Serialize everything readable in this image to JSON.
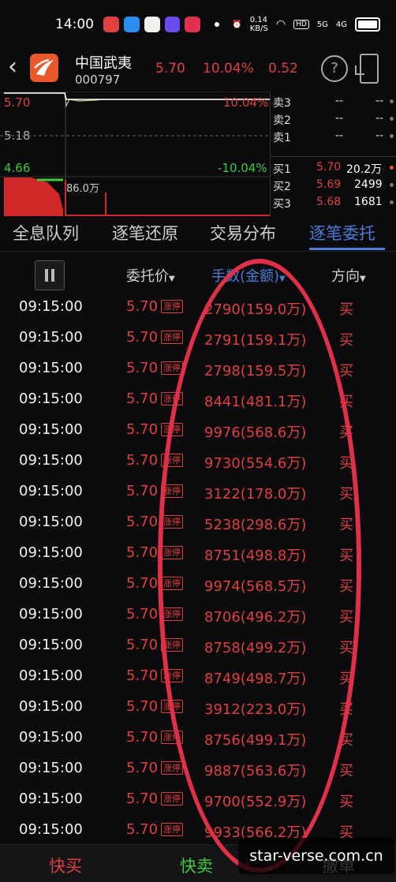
{
  "status": {
    "time": "14:00",
    "net_speed": "0.14",
    "net_unit": "KB/S",
    "hd": "HD",
    "sig1": "5G",
    "sig2": "4G"
  },
  "header": {
    "name": "中国武夷",
    "code": "000797",
    "price": "5.70",
    "pct": "10.04%",
    "change": "0.52"
  },
  "chart": {
    "high": "5.70",
    "high_pct": "10.04%",
    "mid": "5.18",
    "low": "4.66",
    "low_pct": "-10.04%",
    "vol": "86.0万"
  },
  "orderbook": [
    {
      "label": "卖3",
      "price": "--",
      "vol": "--"
    },
    {
      "label": "卖2",
      "price": "--",
      "vol": "--"
    },
    {
      "label": "卖1",
      "price": "--",
      "vol": "--"
    },
    {
      "label": "买1",
      "price": "5.70",
      "vol": "20.2万"
    },
    {
      "label": "买2",
      "price": "5.69",
      "vol": "2499"
    },
    {
      "label": "买3",
      "price": "5.68",
      "vol": "1681"
    }
  ],
  "tabs": [
    "全息队列",
    "逐笔还原",
    "交易分布",
    "逐笔委托"
  ],
  "columns": {
    "price": "委托价",
    "volume": "手数(金额)",
    "direction": "方向"
  },
  "limit_tag": "涨停",
  "rows": [
    {
      "time": "09:15:00",
      "price": "5.70",
      "vol": "2790(159.0万)",
      "dir": "买"
    },
    {
      "time": "09:15:00",
      "price": "5.70",
      "vol": "2791(159.1万)",
      "dir": "买"
    },
    {
      "time": "09:15:00",
      "price": "5.70",
      "vol": "2798(159.5万)",
      "dir": "买"
    },
    {
      "time": "09:15:00",
      "price": "5.70",
      "vol": "8441(481.1万)",
      "dir": "买"
    },
    {
      "time": "09:15:00",
      "price": "5.70",
      "vol": "9976(568.6万)",
      "dir": "买"
    },
    {
      "time": "09:15:00",
      "price": "5.70",
      "vol": "9730(554.6万)",
      "dir": "买"
    },
    {
      "time": "09:15:00",
      "price": "5.70",
      "vol": "3122(178.0万)",
      "dir": "买"
    },
    {
      "time": "09:15:00",
      "price": "5.70",
      "vol": "5238(298.6万)",
      "dir": "买"
    },
    {
      "time": "09:15:00",
      "price": "5.70",
      "vol": "8751(498.8万)",
      "dir": "买"
    },
    {
      "time": "09:15:00",
      "price": "5.70",
      "vol": "9974(568.5万)",
      "dir": "买"
    },
    {
      "time": "09:15:00",
      "price": "5.70",
      "vol": "8706(496.2万)",
      "dir": "买"
    },
    {
      "time": "09:15:00",
      "price": "5.70",
      "vol": "8758(499.2万)",
      "dir": "买"
    },
    {
      "time": "09:15:00",
      "price": "5.70",
      "vol": "8749(498.7万)",
      "dir": "买"
    },
    {
      "time": "09:15:00",
      "price": "5.70",
      "vol": "3912(223.0万)",
      "dir": "买"
    },
    {
      "time": "09:15:00",
      "price": "5.70",
      "vol": "8756(499.1万)",
      "dir": "买"
    },
    {
      "time": "09:15:00",
      "price": "5.70",
      "vol": "9887(563.6万)",
      "dir": "买"
    },
    {
      "time": "09:15:00",
      "price": "5.70",
      "vol": "9700(552.9万)",
      "dir": "买"
    },
    {
      "time": "09:15:00",
      "price": "5.70",
      "vol": "9933(566.2万)",
      "dir": "买"
    }
  ],
  "bottom": {
    "buy": "快买",
    "sell": "快卖",
    "cancel": "撤单"
  },
  "watermark": "star-verse.com.cn",
  "colors": {
    "up": "#e0403c",
    "down": "#3ccc3c",
    "accent": "#4a7cd8",
    "annotation": "#e03048"
  }
}
